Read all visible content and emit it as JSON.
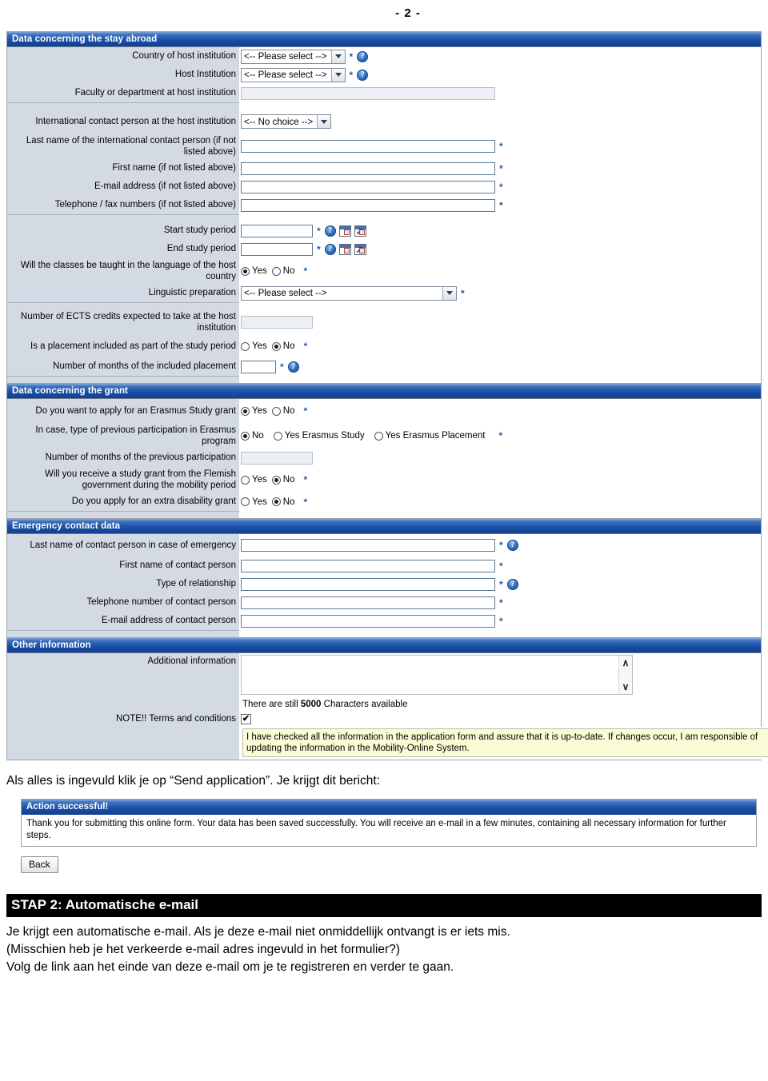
{
  "page": {
    "number": "- 2 -"
  },
  "icons": {
    "help": "?",
    "chevron_down": "chevron-down-icon",
    "scroll_up": "∧",
    "scroll_down": "∨",
    "check": "✔",
    "calendar_arrow": "↗"
  },
  "required_marker": "*",
  "sections": [
    {
      "id": "stay-abroad",
      "title": "Data concerning the stay abroad",
      "fields": [
        {
          "name": "country-of-host-institution",
          "label": "Country of host institution",
          "type": "select",
          "value": "<-- Please select -->",
          "required": true,
          "help": true
        },
        {
          "name": "host-institution",
          "label": "Host Institution",
          "type": "select",
          "value": "<-- Please select -->",
          "required": true,
          "help": true
        },
        {
          "name": "faculty-or-department",
          "label": "Faculty or department at host institution",
          "type": "text-disabled",
          "value": "",
          "required": false,
          "help": false
        },
        {
          "name": "international-contact-person",
          "label": "International contact person at the host institution",
          "type": "select",
          "value": "<-- No choice -->",
          "required": false,
          "help": false
        },
        {
          "name": "contact-last-name",
          "label": "Last name of the international contact person (if not listed above)",
          "type": "text",
          "value": "",
          "required": true,
          "help": false
        },
        {
          "name": "contact-first-name",
          "label": "First name (if not listed above)",
          "type": "text",
          "value": "",
          "required": true,
          "help": false
        },
        {
          "name": "contact-email",
          "label": "E-mail address (if not listed above)",
          "type": "text",
          "value": "",
          "required": true,
          "help": false
        },
        {
          "name": "contact-phone-fax",
          "label": "Telephone / fax numbers (if not listed above)",
          "type": "text",
          "value": "",
          "required": true,
          "help": false
        },
        {
          "name": "start-study-period",
          "label": "Start study period",
          "type": "date",
          "value": "",
          "required": true,
          "help": true
        },
        {
          "name": "end-study-period",
          "label": "End study period",
          "type": "date",
          "value": "",
          "required": true,
          "help": true
        },
        {
          "name": "classes-in-host-language",
          "label": "Will the classes be taught in the language of the host country",
          "type": "radio",
          "required": true,
          "options": [
            {
              "label": "Yes",
              "selected": true
            },
            {
              "label": "No",
              "selected": false
            }
          ]
        },
        {
          "name": "linguistic-preparation",
          "label": "Linguistic preparation",
          "type": "select-wide",
          "value": "<-- Please select -->",
          "required": true,
          "help": false
        },
        {
          "name": "ects-credits",
          "label": "Number of ECTS credits expected to take at the host institution",
          "type": "text-disabled-small",
          "value": "",
          "required": false,
          "help": false
        },
        {
          "name": "placement-included",
          "label": "Is a placement included as part of the study period",
          "type": "radio",
          "required": true,
          "options": [
            {
              "label": "Yes",
              "selected": false
            },
            {
              "label": "No",
              "selected": true
            }
          ]
        },
        {
          "name": "months-of-placement",
          "label": "Number of months of the included placement",
          "type": "text-small",
          "value": "",
          "required": true,
          "help": true
        }
      ]
    },
    {
      "id": "grant",
      "title": "Data concerning the grant",
      "fields": [
        {
          "name": "apply-erasmus-study-grant",
          "label": "Do you want to apply for an Erasmus Study grant",
          "type": "radio",
          "required": true,
          "options": [
            {
              "label": "Yes",
              "selected": true
            },
            {
              "label": "No",
              "selected": false
            }
          ]
        },
        {
          "name": "previous-erasmus-participation",
          "label": "In case, type of previous participation in Erasmus program",
          "type": "radio-wide",
          "required": true,
          "options": [
            {
              "label": "No",
              "selected": true
            },
            {
              "label": "Yes Erasmus Study",
              "selected": false
            },
            {
              "label": "Yes Erasmus Placement",
              "selected": false
            }
          ]
        },
        {
          "name": "months-previous-participation",
          "label": "Number of months of the previous participation",
          "type": "text-disabled-med",
          "value": "",
          "required": false,
          "help": false
        },
        {
          "name": "flemish-study-grant",
          "label": "Will you receive a study grant from the Flemish government during the mobility period",
          "type": "radio",
          "required": true,
          "options": [
            {
              "label": "Yes",
              "selected": false
            },
            {
              "label": "No",
              "selected": true
            }
          ]
        },
        {
          "name": "extra-disability-grant",
          "label": "Do you apply for an extra disability grant",
          "type": "radio",
          "required": true,
          "options": [
            {
              "label": "Yes",
              "selected": false
            },
            {
              "label": "No",
              "selected": true
            }
          ]
        }
      ]
    },
    {
      "id": "emergency-contact",
      "title": "Emergency contact data",
      "fields": [
        {
          "name": "emergency-last-name",
          "label": "Last name of contact person in case of emergency",
          "type": "text",
          "value": "",
          "required": true,
          "help": true
        },
        {
          "name": "emergency-first-name",
          "label": "First name of contact person",
          "type": "text",
          "value": "",
          "required": true,
          "help": false
        },
        {
          "name": "emergency-relationship",
          "label": "Type of relationship",
          "type": "text",
          "value": "",
          "required": true,
          "help": true
        },
        {
          "name": "emergency-telephone",
          "label": "Telephone number of contact person",
          "type": "text",
          "value": "",
          "required": true,
          "help": false
        },
        {
          "name": "emergency-email",
          "label": "E-mail address of contact person",
          "type": "text",
          "value": "",
          "required": true,
          "help": false
        }
      ]
    }
  ],
  "other_information": {
    "title": "Other information",
    "additional_information_label": "Additional information",
    "additional_information_value": "",
    "characters_prefix": "There are still ",
    "characters_count": "5000",
    "characters_suffix": " Characters available",
    "terms_label": "NOTE!! Terms and conditions",
    "terms_checked": true,
    "terms_text": "I have checked all the information in the application form and assure that it is up-to-date. If changes occur, I am responsible of updating the information in the Mobility-Online System."
  },
  "narrative": {
    "send_application_line": "Als alles is ingevuld klik je op “Send application”. Je krijgt dit bericht:"
  },
  "success_box": {
    "title": "Action successful!",
    "body": "Thank you for submitting this online form. Your data has been saved successfully. You will receive an e-mail in a few minutes, containing all necessary information for further steps.",
    "back_label": "Back"
  },
  "step": {
    "banner": "STAP 2: Automatische e-mail",
    "lines": [
      "Je krijgt een automatische e-mail. Als je deze e-mail niet onmiddellijk ontvangt is er iets mis.",
      "(Misschien heb je het verkeerde e-mail adres ingevuld in het formulier?)",
      "Volg de link aan het einde van deze e-mail om je te registreren en verder te gaan."
    ]
  },
  "colors": {
    "header_blue": "#1a50a8",
    "label_bg": "#d4dae4",
    "required_blue": "#1f5fa8",
    "terms_bg": "#fbfbd6",
    "banner_black": "#000000"
  }
}
